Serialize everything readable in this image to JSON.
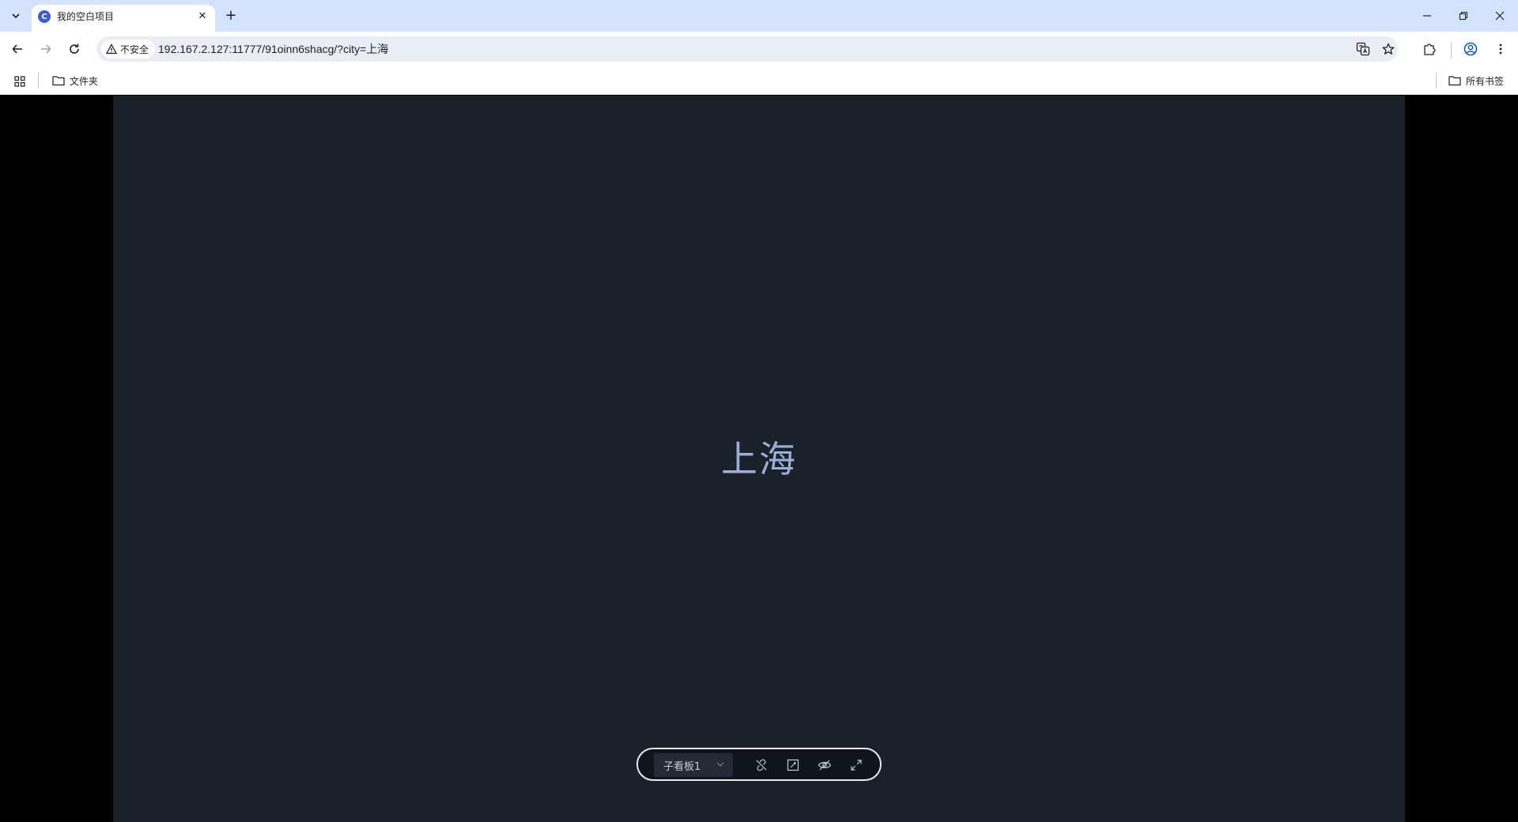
{
  "browser": {
    "tab": {
      "title": "我的空白项目",
      "favicon_letter": "C",
      "close_glyph": "✕"
    },
    "new_tab_glyph": "+",
    "security_label": "不安全",
    "url": "192.167.2.127:11777/91oinn6shacg/?city=上海",
    "bookmarks": {
      "folder_label": "文件夹",
      "all_bookmarks_label": "所有书签"
    }
  },
  "page": {
    "city": "上海",
    "board_select": {
      "selected": "子看板1"
    }
  },
  "colors": {
    "tabstrip": "#d3e3fd",
    "board_background": "#1b212a",
    "city_text": "#9ab0d6"
  }
}
